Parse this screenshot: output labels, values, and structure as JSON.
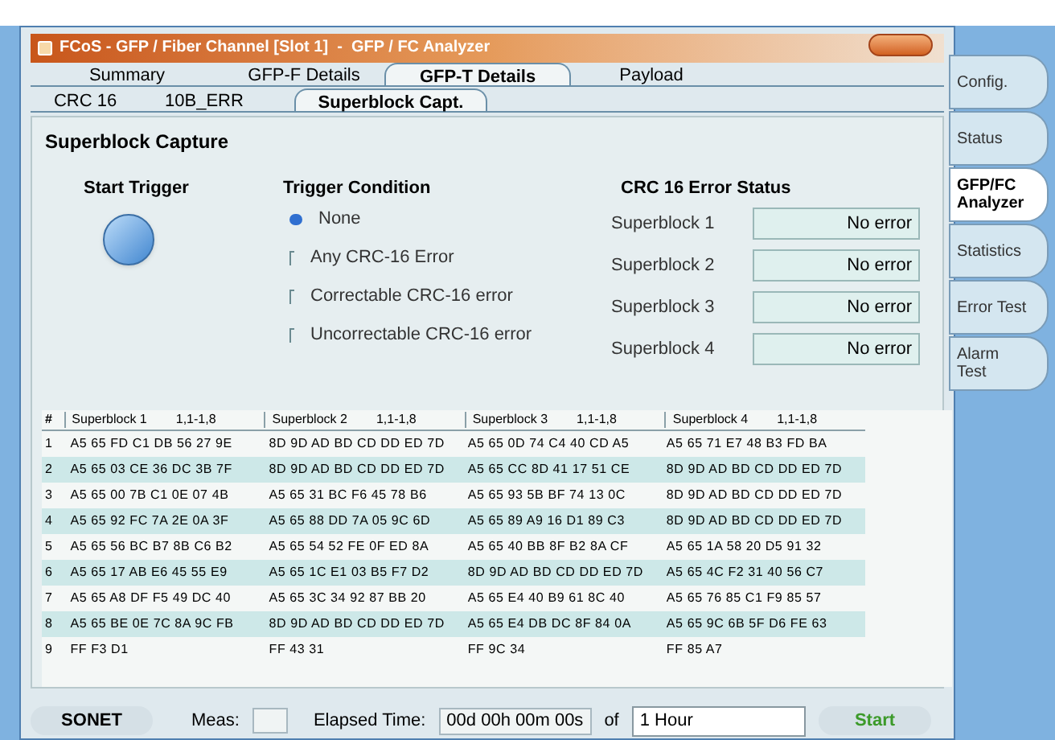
{
  "window": {
    "title": "FCoS - GFP / Fiber Channel [Slot 1]  -  GFP / FC Analyzer"
  },
  "tabs": [
    {
      "label": "Summary",
      "selected": false
    },
    {
      "label": "GFP-F Details",
      "selected": false
    },
    {
      "label": "GFP-T Details",
      "selected": true
    },
    {
      "label": "Payload",
      "selected": false
    }
  ],
  "subtabs": [
    {
      "label": "CRC 16",
      "selected": false
    },
    {
      "label": "10B_ERR",
      "selected": false
    },
    {
      "label": "Superblock Capt.",
      "selected": true
    }
  ],
  "side_tabs": [
    {
      "label": "Config.",
      "selected": false
    },
    {
      "label": "Status",
      "selected": false
    },
    {
      "label": "GFP/FC Analyzer",
      "selected": true
    },
    {
      "label": "Statistics",
      "selected": false
    },
    {
      "label": "Error Test",
      "selected": false
    },
    {
      "label": "Alarm Test",
      "selected": false
    }
  ],
  "panel_title": "Superblock Capture",
  "start_trigger": {
    "label": "Start Trigger"
  },
  "trigger_condition": {
    "label": "Trigger Condition",
    "options": [
      {
        "label": "None",
        "selected": true
      },
      {
        "label": "Any CRC-16 Error",
        "selected": false
      },
      {
        "label": "Correctable CRC-16 error",
        "selected": false
      },
      {
        "label": "Uncorrectable CRC-16 error",
        "selected": false
      }
    ]
  },
  "crc_status": {
    "label": "CRC 16 Error Status",
    "rows": [
      {
        "label": "Superblock 1",
        "value": "No error"
      },
      {
        "label": "Superblock 2",
        "value": "No error"
      },
      {
        "label": "Superblock 3",
        "value": "No error"
      },
      {
        "label": "Superblock 4",
        "value": "No error"
      }
    ]
  },
  "table": {
    "number_header": "#",
    "columns": [
      {
        "name": "Superblock 1",
        "range": "1,1-1,8"
      },
      {
        "name": "Superblock 2",
        "range": "1,1-1,8"
      },
      {
        "name": "Superblock 3",
        "range": "1,1-1,8"
      },
      {
        "name": "Superblock 4",
        "range": "1,1-1,8"
      }
    ],
    "rows": [
      {
        "num": "1",
        "cells": [
          "A5 65 FD C1 DB 56 27 9E",
          "8D 9D AD BD CD DD ED 7D",
          "A5 65 0D 74 C4 40 CD A5",
          "A5 65 71 E7 48 B3 FD BA"
        ]
      },
      {
        "num": "2",
        "cells": [
          "A5 65 03 CE 36 DC 3B 7F",
          "8D 9D AD BD CD DD ED 7D",
          "A5 65 CC 8D 41 17 51 CE",
          "8D 9D AD BD CD DD ED 7D"
        ]
      },
      {
        "num": "3",
        "cells": [
          "A5 65 00 7B C1 0E 07 4B",
          "A5 65 31 BC F6 45 78 B6",
          "A5 65 93 5B BF 74 13 0C",
          "8D 9D AD BD CD DD ED 7D"
        ]
      },
      {
        "num": "4",
        "cells": [
          "A5 65 92 FC 7A 2E 0A 3F",
          "A5 65 88 DD 7A 05 9C 6D",
          "A5 65 89 A9 16 D1 89 C3",
          "8D 9D AD BD CD DD ED 7D"
        ]
      },
      {
        "num": "5",
        "cells": [
          "A5 65 56 BC B7 8B C6 B2",
          "A5 65 54 52 FE 0F ED 8A",
          "A5 65 40 BB 8F B2 8A CF",
          "A5 65 1A 58 20 D5 91 32"
        ]
      },
      {
        "num": "6",
        "cells": [
          "A5 65 17 AB E6 45 55 E9",
          "A5 65 1C E1 03 B5 F7 D2",
          "8D 9D AD BD CD DD ED 7D",
          "A5 65 4C F2 31 40 56 C7"
        ]
      },
      {
        "num": "7",
        "cells": [
          "A5 65 A8 DF F5 49 DC 40",
          "A5 65 3C 34 92 87 BB 20",
          "A5 65 E4 40 B9 61 8C 40",
          "A5 65 76 85 C1 F9 85 57"
        ]
      },
      {
        "num": "8",
        "cells": [
          "A5 65 BE 0E 7C 8A 9C FB",
          "8D 9D AD BD CD DD ED 7D",
          "A5 65 E4 DB DC 8F 84 0A",
          "A5 65 9C 6B 5F D6 FE 63"
        ]
      },
      {
        "num": "9",
        "cells": [
          "FF F3 D1",
          "FF 43 31",
          "FF 9C 34",
          "FF 85 A7"
        ]
      }
    ]
  },
  "status_bar": {
    "mode": "SONET",
    "meas_label": "Meas:",
    "elapsed_label": "Elapsed Time:",
    "elapsed_value": "00d 00h 00m 00s",
    "of_label": "of",
    "duration": "1 Hour",
    "start": "Start"
  }
}
